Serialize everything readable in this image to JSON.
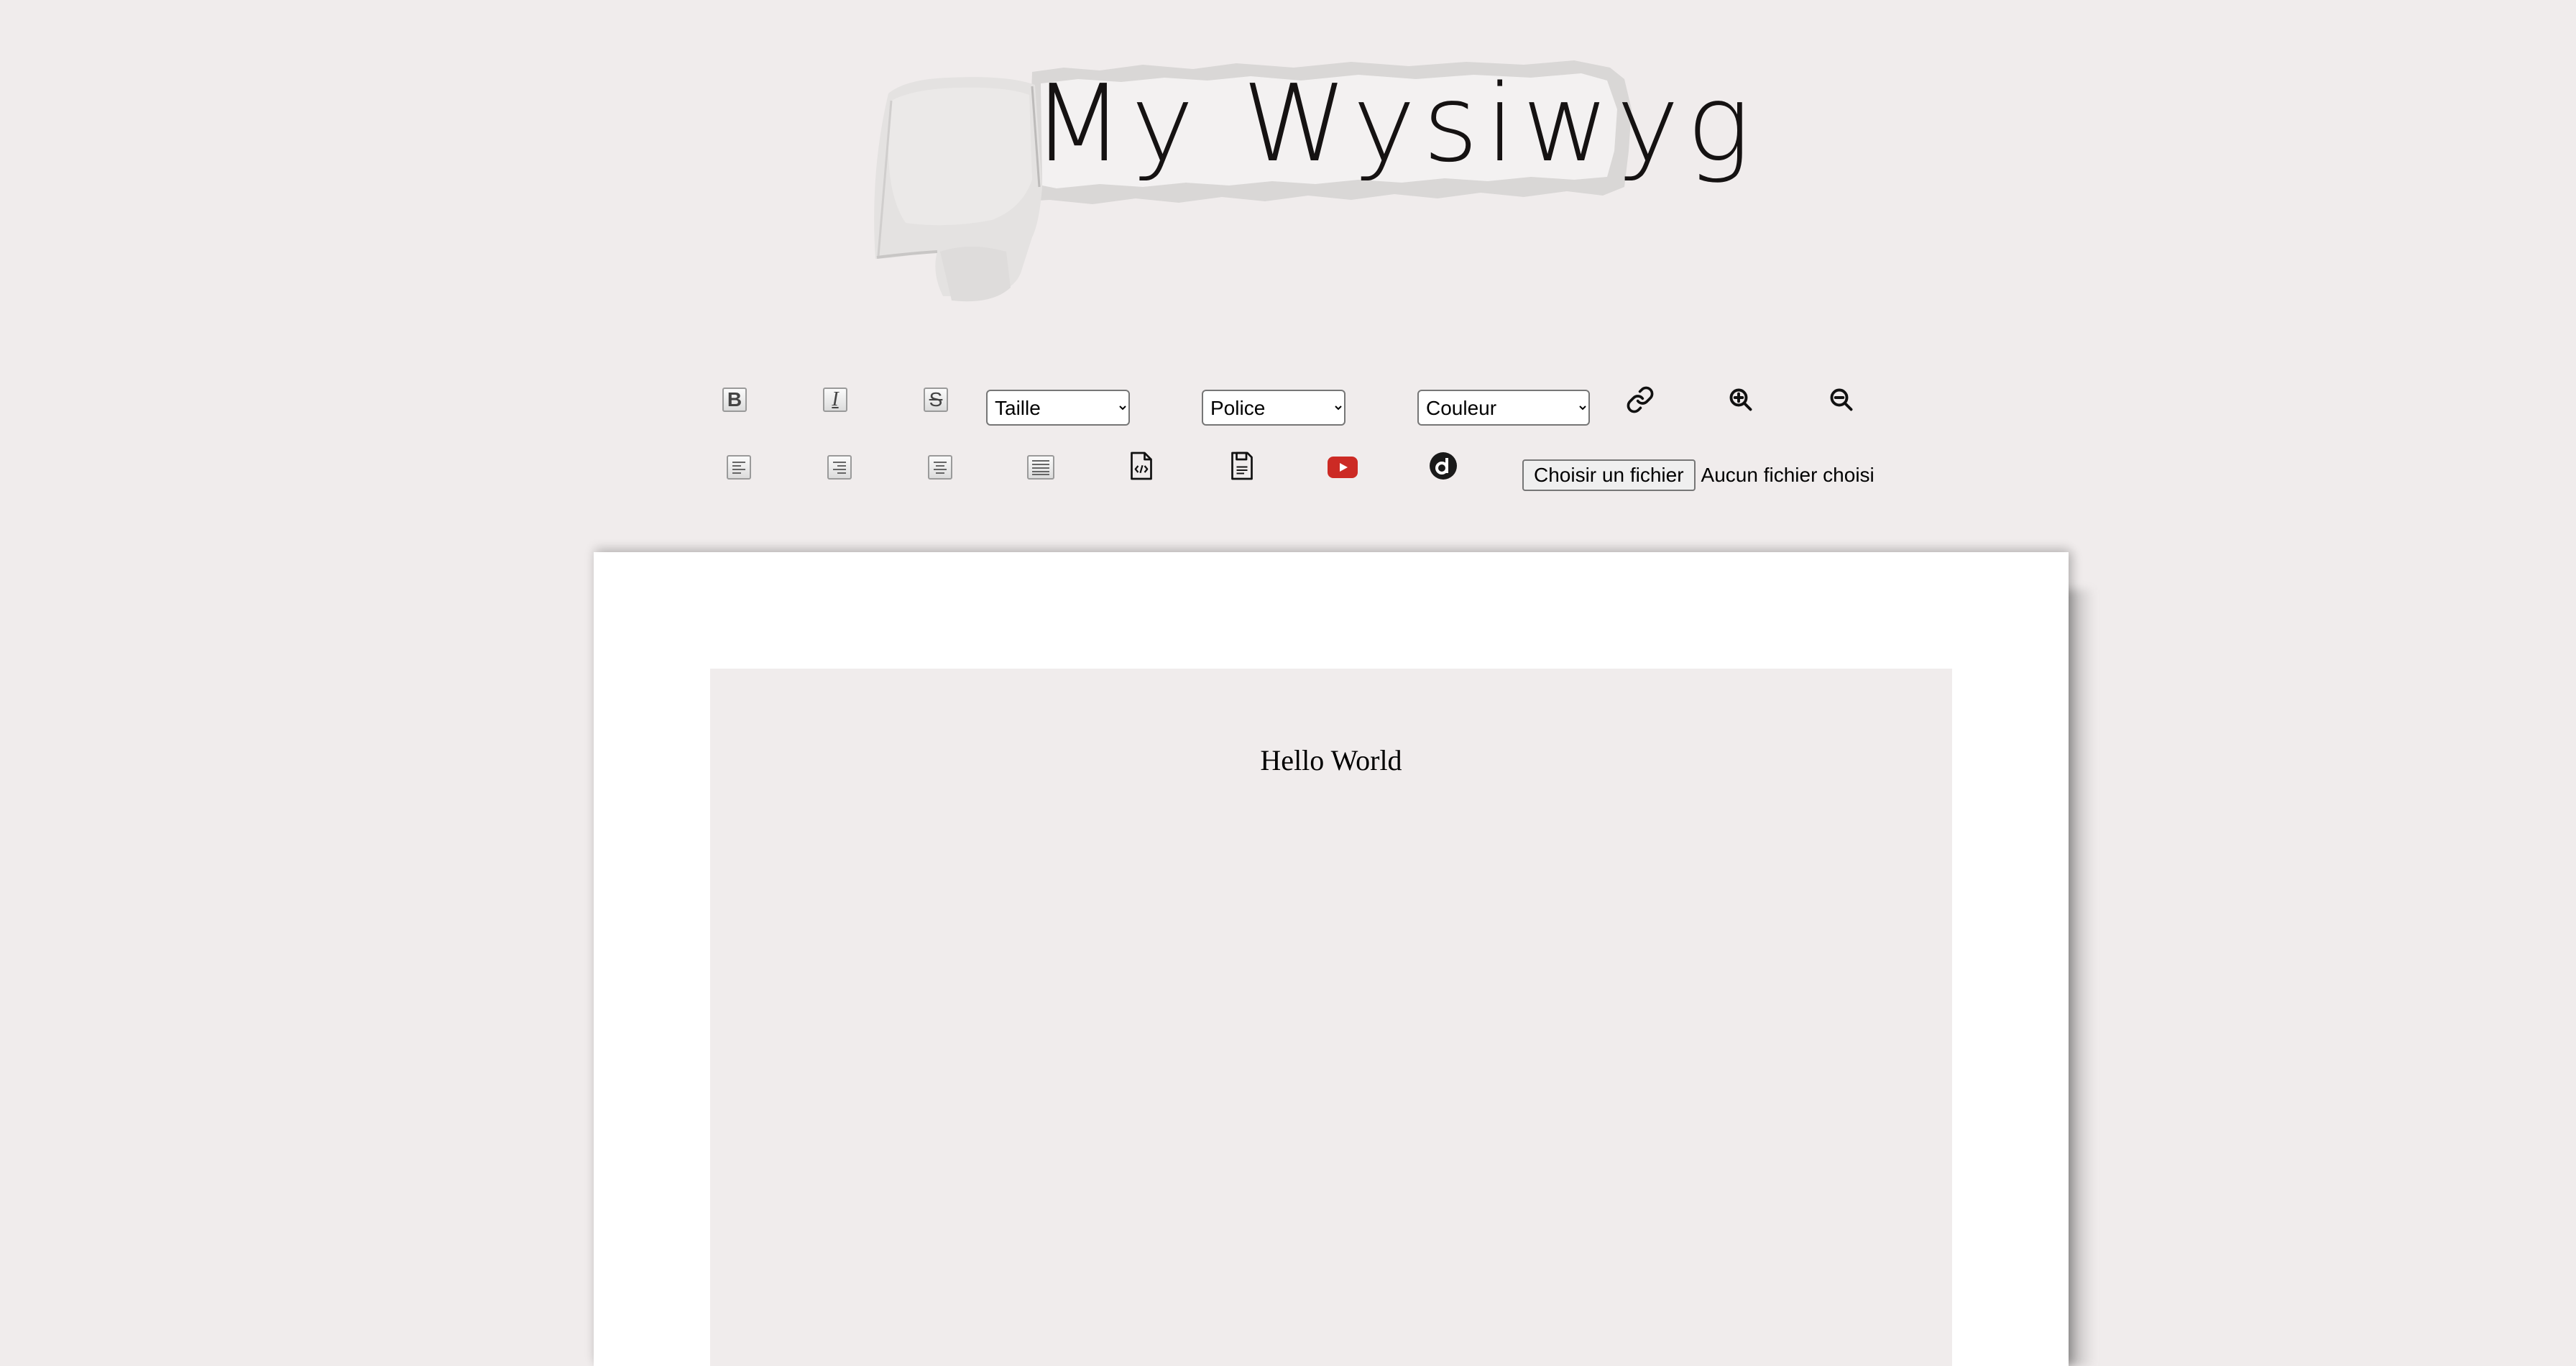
{
  "header": {
    "title": "My Wysiwyg"
  },
  "toolbar": {
    "row1": {
      "bold": {
        "label": "B",
        "icon": "bold-icon"
      },
      "italic": {
        "label": "I",
        "icon": "italic-icon"
      },
      "strike": {
        "label": "S",
        "icon": "strikethrough-icon"
      },
      "size_select": {
        "value": "Taille"
      },
      "font_select": {
        "value": "Police"
      },
      "color_select": {
        "value": "Couleur"
      },
      "link": {
        "icon": "link-icon"
      },
      "zoom_in": {
        "icon": "zoom-in-icon"
      },
      "zoom_out": {
        "icon": "zoom-out-icon"
      }
    },
    "row2": {
      "align_left": {
        "icon": "align-left-icon"
      },
      "align_right": {
        "icon": "align-right-icon"
      },
      "align_center": {
        "icon": "align-center-icon"
      },
      "justify": {
        "icon": "justify-icon"
      },
      "code": {
        "icon": "code-file-icon"
      },
      "save": {
        "icon": "save-file-icon"
      },
      "youtube": {
        "icon": "youtube-icon",
        "color": "#cc2a24"
      },
      "dailymotion": {
        "icon": "dailymotion-icon",
        "color": "#1a1a1a"
      },
      "file_button": "Choisir un fichier",
      "file_status": "Aucun fichier choisi"
    }
  },
  "editor": {
    "content": "Hello World"
  },
  "colors": {
    "background": "#f0ecec",
    "sheet": "#ffffff",
    "editor": "#f0ecec"
  }
}
